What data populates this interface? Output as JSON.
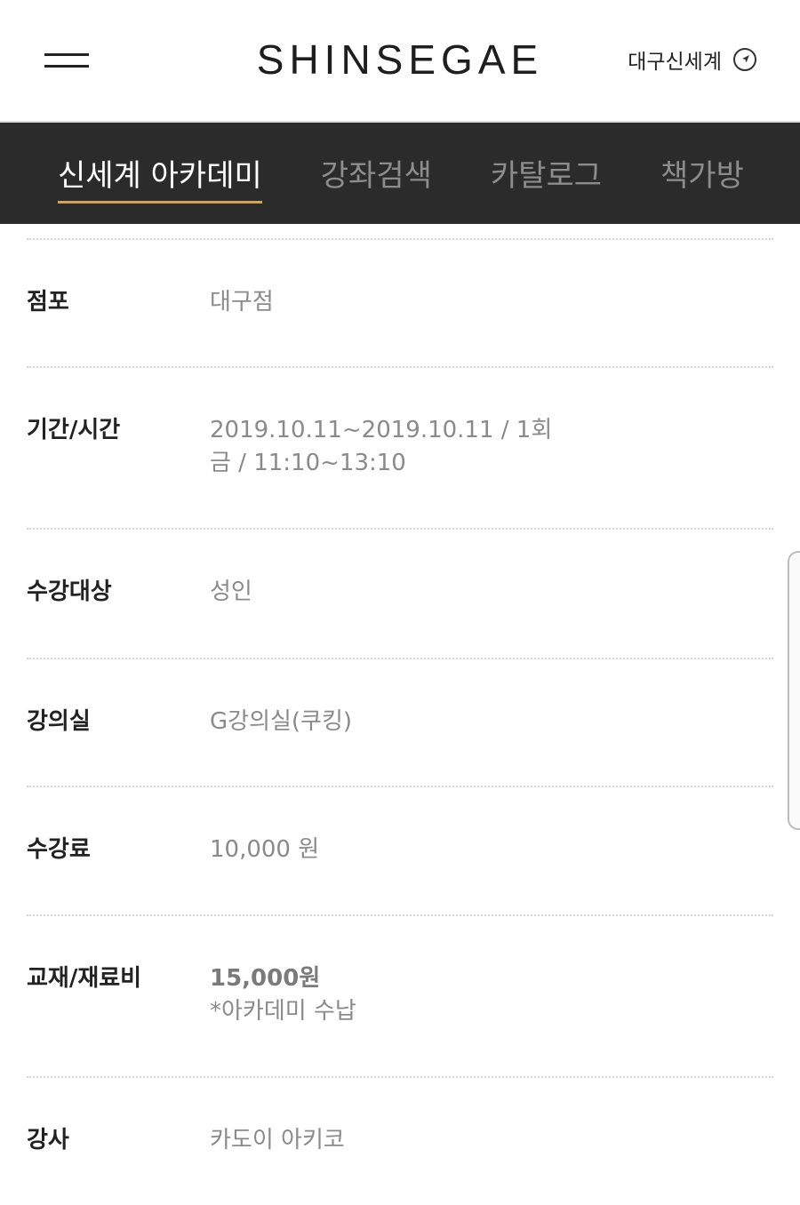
{
  "header": {
    "logo": "SHINSEGAE",
    "store": "대구신세계"
  },
  "tabs": [
    {
      "label": "신세계 아카데미",
      "active": true
    },
    {
      "label": "강좌검색",
      "active": false
    },
    {
      "label": "카탈로그",
      "active": false
    },
    {
      "label": "책가방",
      "active": false
    }
  ],
  "details": {
    "store": {
      "label": "점포",
      "value": "대구점"
    },
    "period": {
      "label": "기간/시간",
      "line1": "2019.10.11~2019.10.11 / 1회",
      "line2": "금 / 11:10~13:10"
    },
    "target": {
      "label": "수강대상",
      "value": "성인"
    },
    "room": {
      "label": "강의실",
      "value": "G강의실(쿠킹)"
    },
    "fee": {
      "label": "수강료",
      "value": "10,000 원"
    },
    "materials": {
      "label": "교재/재료비",
      "amount": "15,000원",
      "note": "*아카데미 수납"
    },
    "instructor": {
      "label": "강사",
      "value": "카도이 아키코"
    }
  },
  "colors": {
    "tabbar_bg": "#2b2b2b",
    "active_underline": "#c9a46a",
    "value_text": "#8a8a8a"
  }
}
